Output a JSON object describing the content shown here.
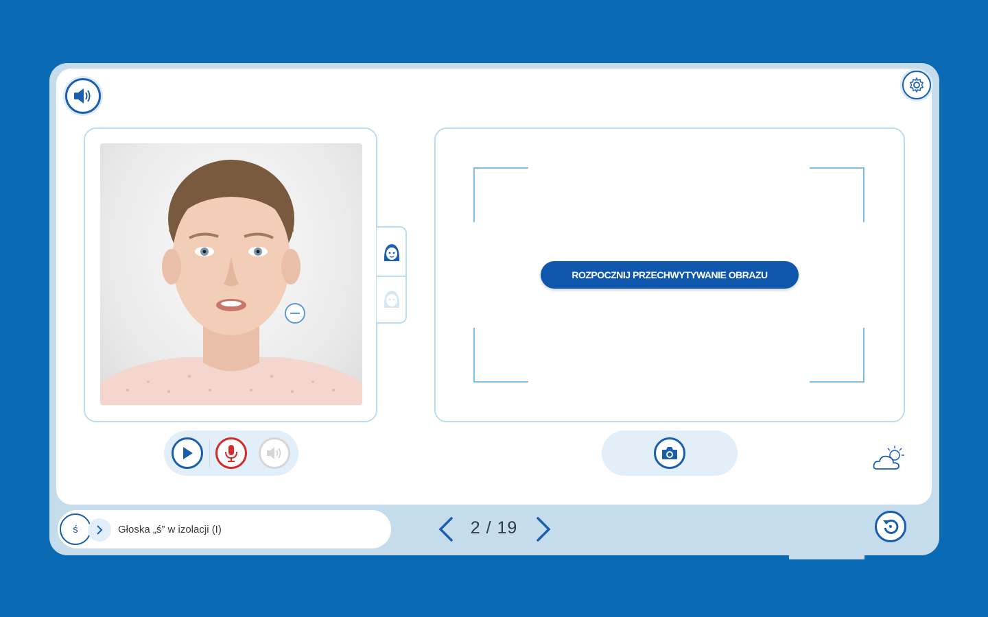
{
  "colors": {
    "background": "#0a6ab3",
    "frame": "#c4dcec",
    "accent": "#1a5eb0",
    "button_primary": "#0e57ac",
    "mic_red": "#d22b2b",
    "panel_border": "#b9dcf4"
  },
  "header": {
    "sound_icon": "speaker-icon",
    "settings_icon": "gear-icon"
  },
  "left_panel": {
    "photo": "girl-face-photo",
    "tabs": [
      "face-front-icon",
      "face-side-icon"
    ],
    "minus_icon": "minus-icon"
  },
  "right_panel": {
    "capture_label": "ROZPOCZNIJ PRZECHWYTYWANIE OBRAZU"
  },
  "controls": {
    "play_icon": "play-icon",
    "mic_icon": "microphone-icon",
    "speaker_icon": "speaker-muted-icon",
    "camera_icon": "camera-icon",
    "weather_icon": "cloud-sun-icon"
  },
  "footer": {
    "letter": "ś",
    "lesson_title": "Głoska „ś” w izolacji (I)",
    "page_indicator": "2 / 19",
    "reset_icon": "reset-icon"
  }
}
